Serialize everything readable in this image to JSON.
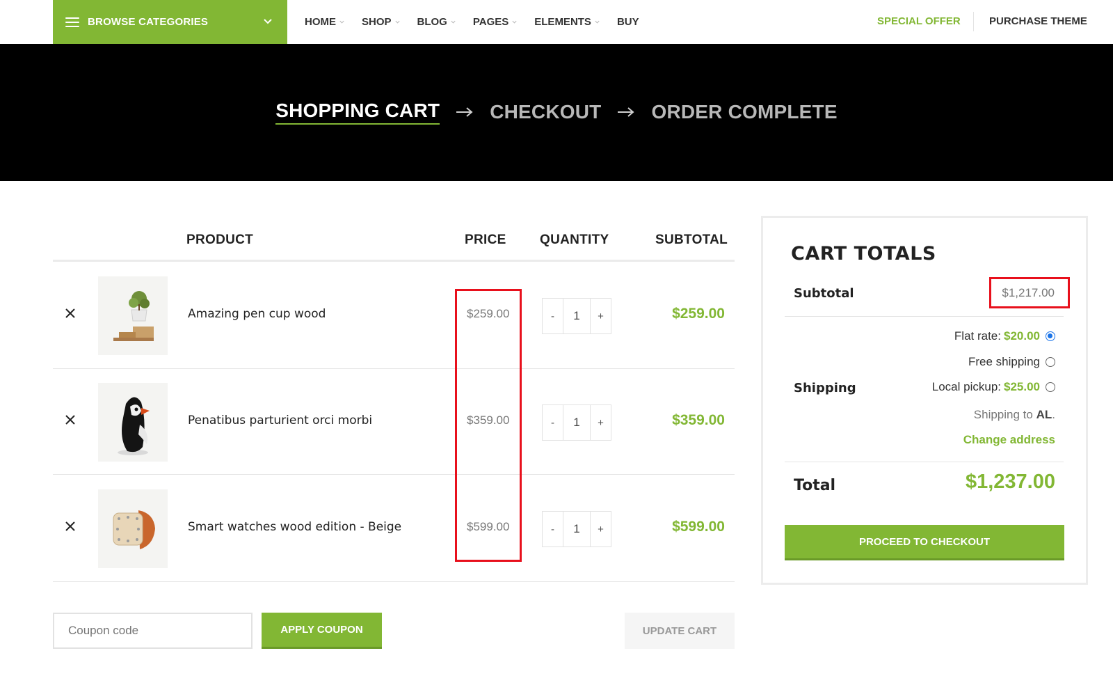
{
  "nav": {
    "browse_label": "BROWSE CATEGORIES",
    "menu": [
      {
        "label": "HOME",
        "dropdown": true
      },
      {
        "label": "SHOP",
        "dropdown": true
      },
      {
        "label": "BLOG",
        "dropdown": true
      },
      {
        "label": "PAGES",
        "dropdown": true
      },
      {
        "label": "ELEMENTS",
        "dropdown": true
      },
      {
        "label": "BUY",
        "dropdown": false
      }
    ],
    "special_offer": "SPECIAL OFFER",
    "purchase_theme": "PURCHASE THEME"
  },
  "steps": {
    "cart": "SHOPPING CART",
    "checkout": "CHECKOUT",
    "complete": "ORDER COMPLETE"
  },
  "table": {
    "headers": {
      "product": "PRODUCT",
      "price": "PRICE",
      "quantity": "QUANTITY",
      "subtotal": "SUBTOTAL"
    },
    "rows": [
      {
        "name": "Amazing pen cup wood",
        "price": "$259.00",
        "qty": "1",
        "subtotal": "$259.00",
        "thumb": "pen-cup-plant"
      },
      {
        "name": "Penatibus parturient orci morbi",
        "price": "$359.00",
        "qty": "1",
        "subtotal": "$359.00",
        "thumb": "puffin-figure"
      },
      {
        "name": "Smart watches wood edition - Beige",
        "price": "$599.00",
        "qty": "1",
        "subtotal": "$599.00",
        "thumb": "wood-watch"
      }
    ],
    "qty_minus": "-",
    "qty_plus": "+"
  },
  "coupon": {
    "placeholder": "Coupon code",
    "apply_label": "APPLY COUPON",
    "update_label": "UPDATE CART"
  },
  "totals": {
    "title": "CART TOTALS",
    "subtotal_label": "Subtotal",
    "subtotal_value": "$1,217.00",
    "shipping_label": "Shipping",
    "options": [
      {
        "label": "Flat rate:",
        "amount": "$20.00",
        "selected": true
      },
      {
        "label": "Free shipping",
        "amount": "",
        "selected": false
      },
      {
        "label": "Local pickup:",
        "amount": "$25.00",
        "selected": false
      }
    ],
    "shipping_to_prefix": "Shipping to",
    "shipping_to_value": "AL",
    "shipping_to_suffix": ".",
    "change_address": "Change address",
    "total_label": "Total",
    "total_value": "$1,237.00",
    "checkout_label": "PROCEED TO CHECKOUT"
  },
  "colors": {
    "accent": "#82b734",
    "hero_bg": "#000000",
    "highlight_box": "#e8101c"
  }
}
